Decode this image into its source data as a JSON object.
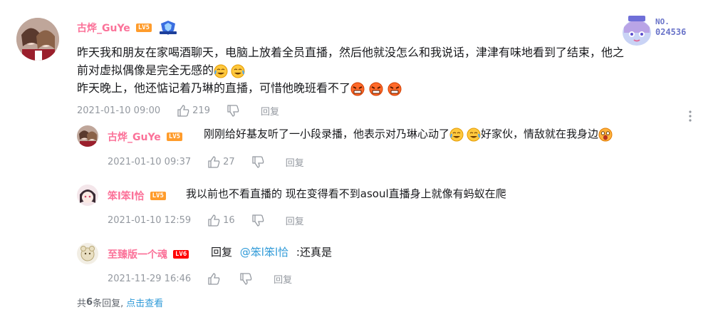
{
  "comment": {
    "username": "古烨_GuYe",
    "level": "LV5",
    "level_color": "#ff9c2c",
    "text_line1": "昨天我和朋友在家喝酒聊天，电脑上放着全员直播，然后他就没怎么和我说话，津津有味地看到了结束，他之",
    "text_line2": "前对虚拟偶像是完全无感的",
    "text_line3": "昨天晚上，他还惦记着乃琳的直播，可惜他晚班看不了",
    "time": "2021-01-10 09:00",
    "likes": "219",
    "reply_label": "回复",
    "badge_no": "NO.",
    "badge_num": "024536"
  },
  "replies": [
    {
      "username": "古烨_GuYe",
      "level": "LV5",
      "level_color": "#ff9c2c",
      "text_a": "刚刚给好基友听了一小段录播，他表示对乃琳心动了",
      "text_b": "好家伙，情敌就在我身边",
      "time": "2021-01-10 09:37",
      "likes": "27",
      "reply_label": "回复"
    },
    {
      "username": "笨l笨l恰",
      "level": "LV5",
      "level_color": "#ff9c2c",
      "text": "我以前也不看直播的 现在变得看不到asoul直播身上就像有蚂蚁在爬",
      "time": "2021-01-10 12:59",
      "likes": "16",
      "reply_label": "回复"
    },
    {
      "username": "至臻版一个魂",
      "level": "LV6",
      "level_color": "#ff0000",
      "prefix": "回复",
      "mention": "@笨l笨l恰",
      "text": ":还真是",
      "time": "2021-11-29 16:46",
      "reply_label": "回复"
    }
  ],
  "footer": {
    "prefix": "共",
    "count": "6",
    "suffix": "条回复,",
    "link": "点击查看"
  },
  "colors": {
    "username": "#fb7299",
    "meta": "#9499a0",
    "link": "#2f9ad8"
  }
}
